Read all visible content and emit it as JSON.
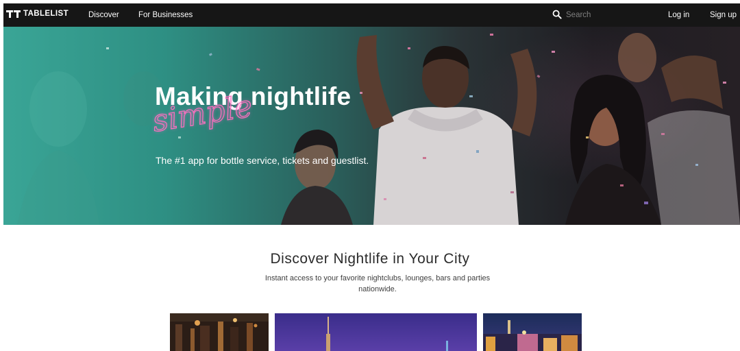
{
  "nav": {
    "logo_text": "TABLELIST",
    "discover_label": "Discover",
    "for_businesses_label": "For Businesses",
    "search_placeholder": "Search",
    "login_label": "Log in",
    "signup_label": "Sign up"
  },
  "hero": {
    "title": "Making nightlife",
    "script_word": "simple",
    "subtitle": "The #1 app for bottle service, tickets and guestlist."
  },
  "discover": {
    "title": "Discover Nightlife in Your City",
    "description": "Instant access to your favorite nightclubs, lounges, bars and parties nationwide."
  },
  "city_cards": [
    {
      "icon": "club-interior-photo"
    },
    {
      "icon": "city-night-skyline-photo"
    },
    {
      "icon": "las-vegas-strip-photo"
    }
  ],
  "colors": {
    "nav_bg": "#161616",
    "hero_teal": "#3aa596",
    "script_pink": "#ff6fc0"
  }
}
